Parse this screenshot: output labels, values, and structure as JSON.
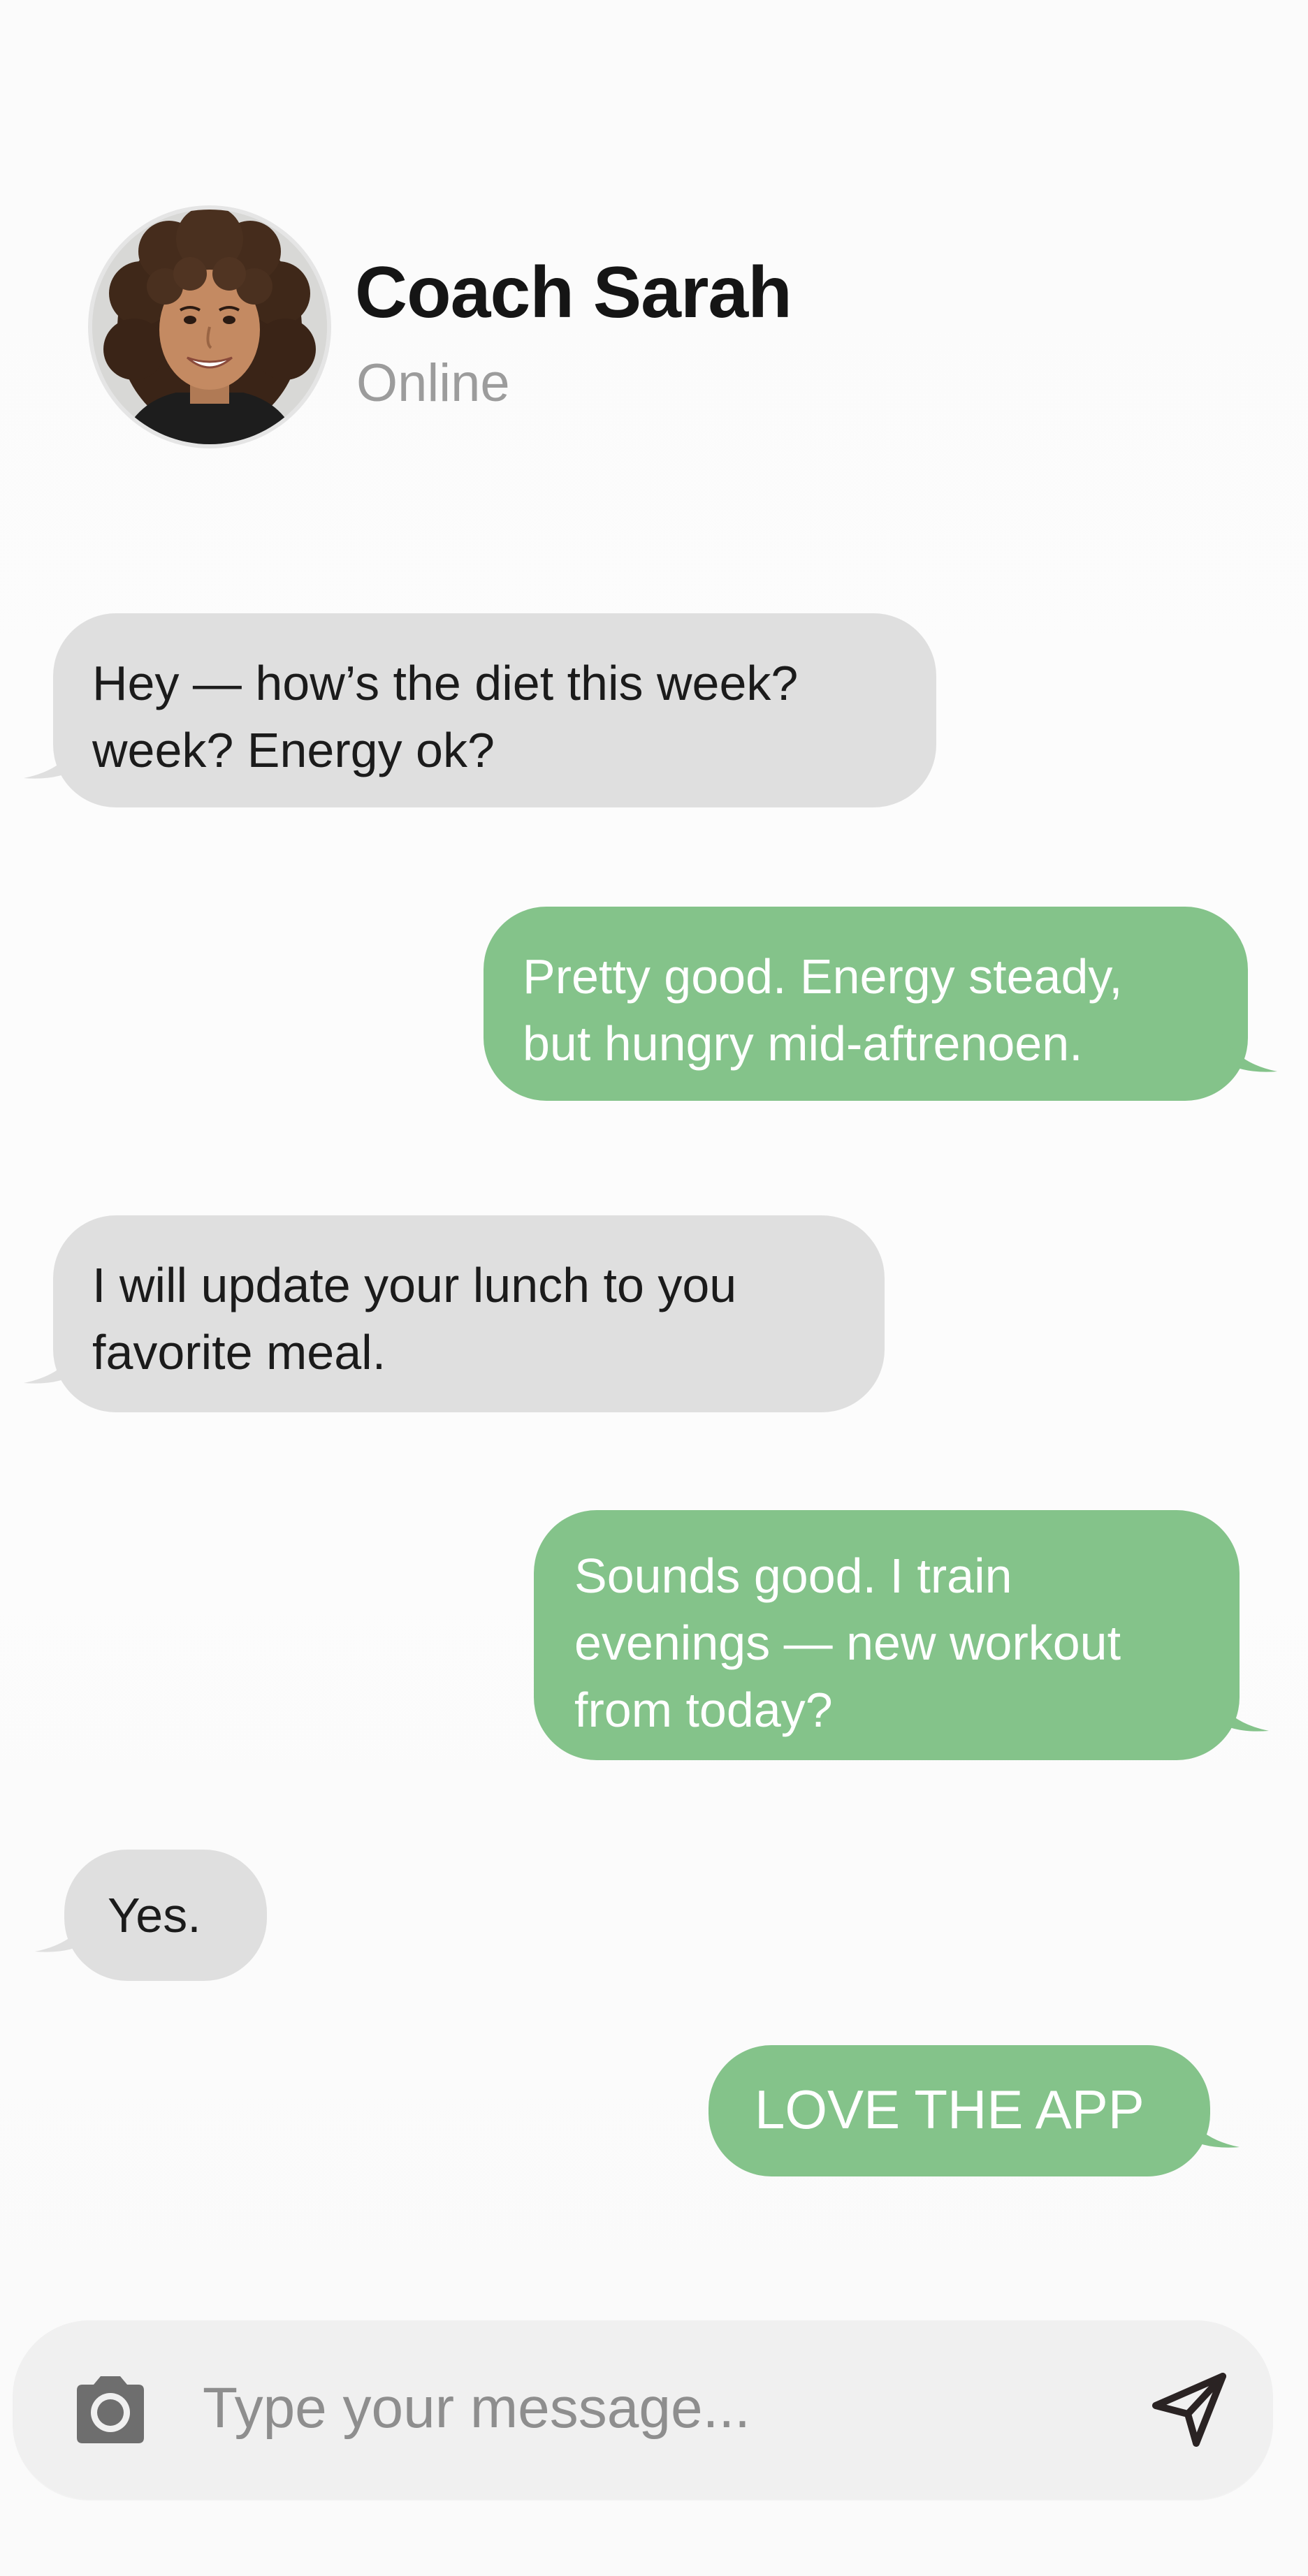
{
  "contact": {
    "name": "Coach Sarah",
    "status": "Online"
  },
  "messages": [
    {
      "direction": "incoming",
      "text": "Hey — how’s the diet this week?\nweek? Energy ok?"
    },
    {
      "direction": "outgoing",
      "text": "Pretty good. Energy steady,\nbut hungry mid-aftrenoen."
    },
    {
      "direction": "incoming",
      "text": "I will update your lunch to you\nfavorite meal."
    },
    {
      "direction": "outgoing",
      "text": "Sounds good. I train\nevenings — new workout\nfrom today?"
    },
    {
      "direction": "incoming",
      "text": "Yes."
    },
    {
      "direction": "outgoing",
      "text": "LOVE THE APP"
    }
  ],
  "composer": {
    "placeholder": "Type your message...",
    "camera_icon": "camera-icon",
    "send_icon": "send-icon"
  },
  "colors": {
    "background": "#fbfbfb",
    "incoming_bubble": "#dfdfdf",
    "outgoing_bubble": "#84c38a",
    "status_text": "#9c9c9c"
  }
}
